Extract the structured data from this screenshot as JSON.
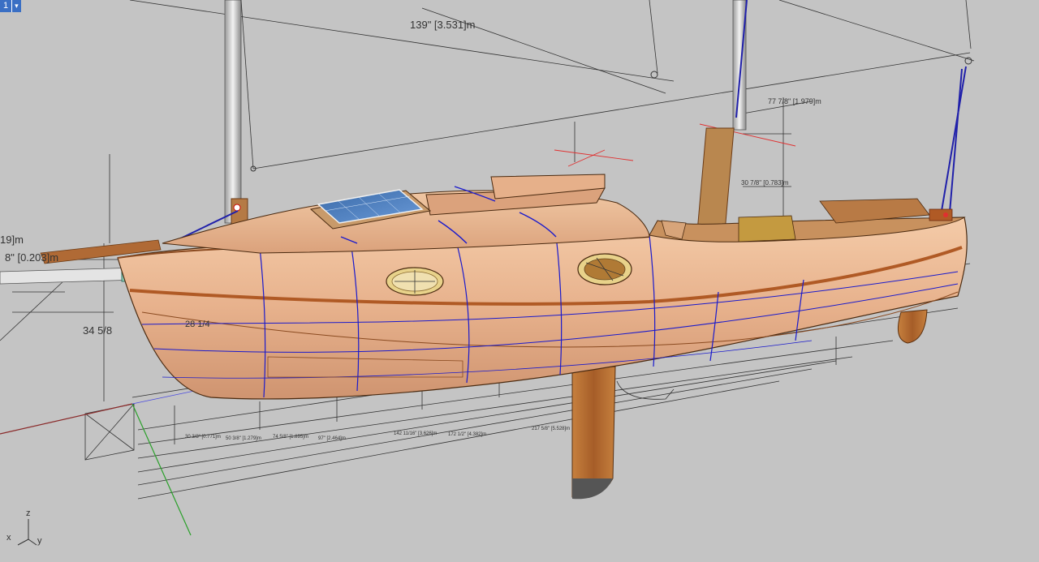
{
  "viewport": {
    "number": "1",
    "menu_arrow": "▾"
  },
  "dimensions": {
    "overall_top": "139\" [3.531]m",
    "mast_aft": "77 7/8\" [1.979]m",
    "mast_tab": "30 7/8\" [0.783]m",
    "left_partial_1": "19]m",
    "left_partial_2": "8\" [0.203]m",
    "depth": "34 5/8",
    "beam_offset": "28 1/4",
    "station_1": "30 3/8\" [0.771]m",
    "station_2": "50 3/8\" [1.279]m",
    "station_3": "74 5/8\" [1.895]m",
    "station_4": "97\" [2.464]m",
    "station_5": "142 11/16\" [3.626]m",
    "station_6": "172 1/2\" [4.382]m",
    "station_7": "217 5/8\" [5.528]m"
  },
  "axes": {
    "z": "z",
    "x": "x",
    "y": "y"
  },
  "colors": {
    "background": "#c4c4c4",
    "hull": "#e8b48e",
    "wood": "#b8703a",
    "construction_line": "#1a1acc",
    "x_axis": "#8a2a2a",
    "y_axis": "#2aa02a"
  }
}
